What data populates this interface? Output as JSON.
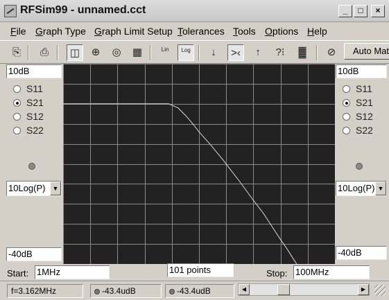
{
  "window": {
    "title": "RFSim99 - unnamed.cct"
  },
  "controls": {
    "minimize": "_",
    "maximize": "□",
    "close": "×"
  },
  "menu": [
    "File",
    "Graph Type",
    "Graph Limit Setup",
    "Tolerances",
    "Tools",
    "Options",
    "Help"
  ],
  "toolbar": {
    "buttons": [
      {
        "name": "copy-icon",
        "glyph": "⎘"
      },
      {
        "name": "print-icon",
        "glyph": "⎙"
      },
      {
        "name": "rect-graph-icon",
        "glyph": "◫"
      },
      {
        "name": "smith-chart-icon",
        "glyph": "⊕"
      },
      {
        "name": "polar-chart-icon",
        "glyph": "◎"
      },
      {
        "name": "table-icon",
        "glyph": "▦"
      },
      {
        "name": "lin-scale-icon",
        "glyph": "Lin"
      },
      {
        "name": "log-scale-icon",
        "glyph": "Log"
      },
      {
        "name": "arrow-down-icon",
        "glyph": "↓"
      },
      {
        "name": "zoom-in-icon",
        "glyph": ">‹"
      },
      {
        "name": "arrow-up-icon",
        "glyph": "↑"
      },
      {
        "name": "tune-icon",
        "glyph": "?⁝"
      },
      {
        "name": "component-icon",
        "glyph": "▓"
      },
      {
        "name": "clock-icon",
        "glyph": "⊘"
      }
    ],
    "auto_match": "Auto Match"
  },
  "left_panel": {
    "top_value": "10dB",
    "params": [
      {
        "label": "S11",
        "checked": false
      },
      {
        "label": "S21",
        "checked": true
      },
      {
        "label": "S12",
        "checked": false
      },
      {
        "label": "S22",
        "checked": false
      }
    ],
    "scale": "10Log(P)",
    "bottom_value": "-40dB"
  },
  "right_panel": {
    "top_value": "10dB",
    "params": [
      {
        "label": "S11",
        "checked": false
      },
      {
        "label": "S21",
        "checked": true
      },
      {
        "label": "S12",
        "checked": false
      },
      {
        "label": "S22",
        "checked": false
      }
    ],
    "scale": "10Log(P)",
    "bottom_value": "-40dB"
  },
  "sweep": {
    "start_label": "Start:",
    "start_value": "1MHz",
    "points": "101 points",
    "stop_label": "Stop:",
    "stop_value": "100MHz"
  },
  "status": {
    "frequency": "f=3.162MHz",
    "left_reading": "-43.4udB",
    "right_reading": "-43.4udB"
  },
  "colors": {
    "graph_background": "#222222",
    "grid": "#8a8a8a",
    "trace": "#d8d8d8"
  },
  "chart_data": {
    "type": "line",
    "x_scale": "log",
    "xlim_mhz": [
      1,
      100
    ],
    "ylim_db": [
      -40,
      10
    ],
    "grid": true,
    "series": [
      {
        "x": [
          1,
          2,
          3,
          4,
          5,
          6,
          7,
          8,
          9,
          10,
          12,
          15,
          20,
          25,
          30,
          35,
          40,
          45,
          50,
          60
        ],
        "values": [
          0,
          0,
          0,
          0,
          0,
          0,
          -1,
          -3,
          -5,
          -7,
          -10,
          -14,
          -19.5,
          -24,
          -27.5,
          -31,
          -34,
          -36.5,
          -39,
          -43
        ]
      }
    ]
  }
}
